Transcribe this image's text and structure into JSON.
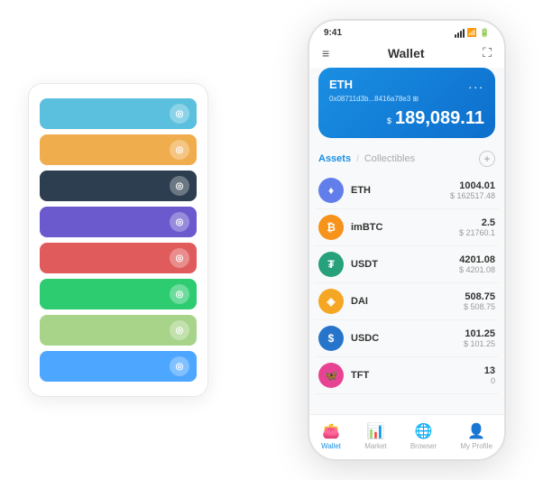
{
  "scene": {
    "background": "#ffffff"
  },
  "card_stack": {
    "rows": [
      {
        "color": "#5bc0de",
        "icon": "◎",
        "label": "blue-card"
      },
      {
        "color": "#f0ad4e",
        "icon": "◎",
        "label": "orange-card"
      },
      {
        "color": "#2c3e50",
        "icon": "◎",
        "label": "dark-card"
      },
      {
        "color": "#6a5acd",
        "icon": "◎",
        "label": "purple-card"
      },
      {
        "color": "#e05c5c",
        "icon": "◎",
        "label": "red-card"
      },
      {
        "color": "#2ecc71",
        "icon": "◎",
        "label": "green-card"
      },
      {
        "color": "#a8d48a",
        "icon": "◎",
        "label": "light-green-card"
      },
      {
        "color": "#4da6ff",
        "icon": "◎",
        "label": "light-blue-card"
      }
    ]
  },
  "phone": {
    "status_bar": {
      "time": "9:41",
      "signal": "●●●",
      "wifi": "▲",
      "battery": "▐"
    },
    "nav": {
      "menu_icon": "≡",
      "title": "Wallet",
      "expand_icon": "⛶"
    },
    "eth_card": {
      "title": "ETH",
      "address": "0x08711d3b...8416a78e3",
      "address_icon": "⊞",
      "menu": "...",
      "currency": "$",
      "balance": "189,089.11"
    },
    "assets_section": {
      "tab_active": "Assets",
      "divider": "/",
      "tab_inactive": "Collectibles",
      "add_icon": "+"
    },
    "assets": [
      {
        "symbol": "ETH",
        "icon_color": "#627eea",
        "icon_text": "♦",
        "amount": "1004.01",
        "usd": "$ 162517.48"
      },
      {
        "symbol": "imBTC",
        "icon_color": "#f7931a",
        "icon_text": "₿",
        "amount": "2.5",
        "usd": "$ 21760.1"
      },
      {
        "symbol": "USDT",
        "icon_color": "#26a17b",
        "icon_text": "₮",
        "amount": "4201.08",
        "usd": "$ 4201.08"
      },
      {
        "symbol": "DAI",
        "icon_color": "#f5a623",
        "icon_text": "◈",
        "amount": "508.75",
        "usd": "$ 508.75"
      },
      {
        "symbol": "USDC",
        "icon_color": "#2775ca",
        "icon_text": "$",
        "amount": "101.25",
        "usd": "$ 101.25"
      },
      {
        "symbol": "TFT",
        "icon_color": "#e84393",
        "icon_text": "🦋",
        "amount": "13",
        "usd": "0"
      }
    ],
    "bottom_nav": [
      {
        "icon": "👛",
        "label": "Wallet",
        "active": true
      },
      {
        "icon": "📊",
        "label": "Market",
        "active": false
      },
      {
        "icon": "🌐",
        "label": "Browser",
        "active": false
      },
      {
        "icon": "👤",
        "label": "My Profile",
        "active": false
      }
    ]
  }
}
